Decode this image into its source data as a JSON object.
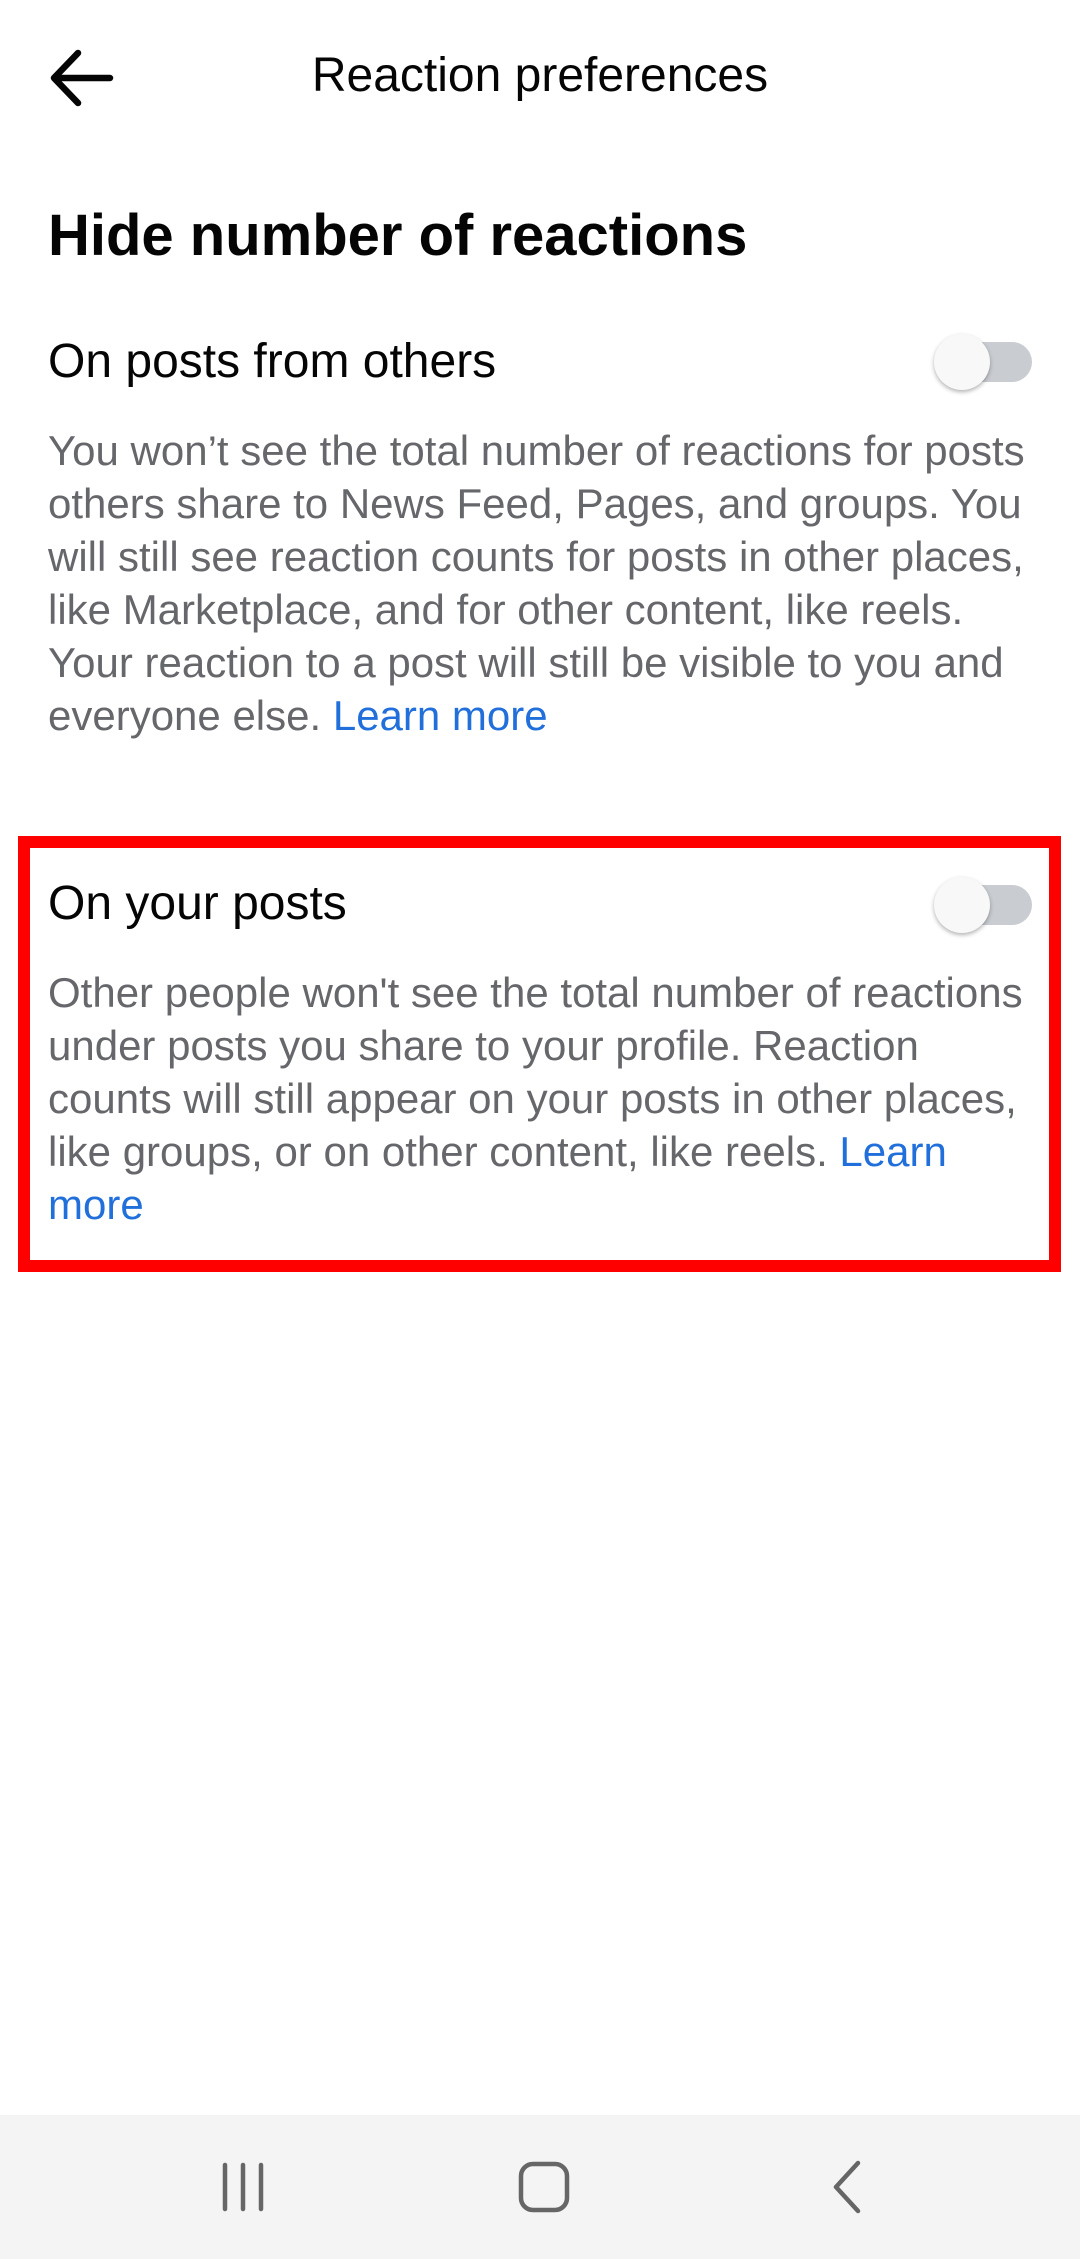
{
  "header": {
    "title": "Reaction preferences",
    "back_icon": "arrow-left-icon"
  },
  "section": {
    "title": "Hide number of reactions"
  },
  "settings": [
    {
      "title": "On posts from others",
      "description": "You won’t see the total number of reactions for posts others share to News Feed, Pages, and groups. You will still see reaction counts for posts in other places, like Marketplace, and for other content, like reels. Your reaction to a post will still be visible to you and everyone else.",
      "link": "Learn more",
      "enabled": false
    },
    {
      "title": "On your posts",
      "description": "Other people won't see the total number of reactions under posts you share to your profile. Reaction counts will still appear on your posts in other places, like groups, or on other content, like reels.",
      "link": "Learn more",
      "enabled": false
    }
  ],
  "nav": {
    "recents_icon": "recents-icon",
    "home_icon": "home-icon",
    "back_icon": "back-chevron-icon"
  },
  "colors": {
    "link": "#216fdb",
    "secondary_text": "#65676b",
    "toggle_off": "#c9ccd1",
    "highlight": "#ff0000"
  }
}
